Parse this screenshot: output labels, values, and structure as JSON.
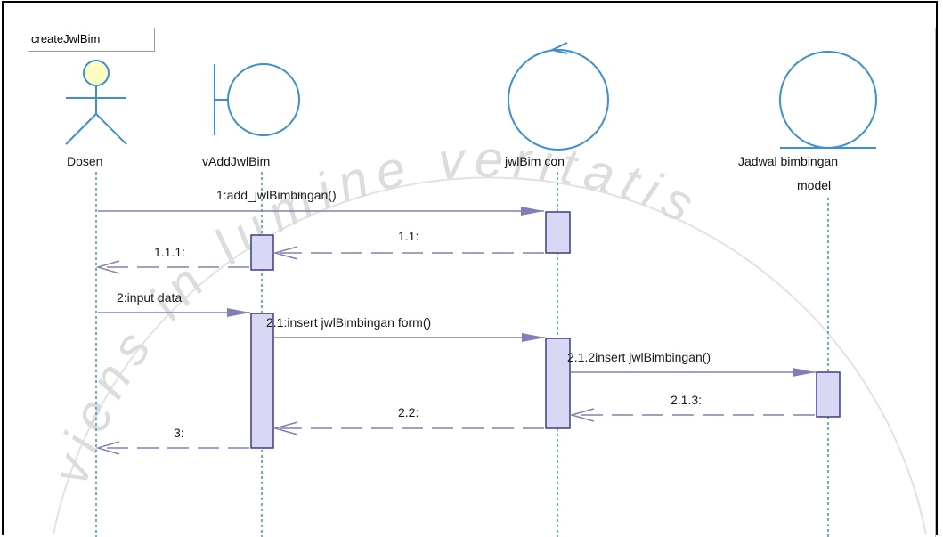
{
  "frame": {
    "name": "createJwlBim"
  },
  "lifelines": [
    {
      "id": "dosen",
      "kind": "actor",
      "name": "Dosen"
    },
    {
      "id": "view",
      "kind": "boundary",
      "name": "vAddJwlBim"
    },
    {
      "id": "controller",
      "kind": "control",
      "name": "jwlBim con"
    },
    {
      "id": "model",
      "kind": "entity",
      "name_line1": "Jadwal bimbingan",
      "name_line2": "model"
    }
  ],
  "messages": [
    {
      "label": "1:add_jwlBimbingan()",
      "from": "dosen",
      "to": "controller",
      "type": "call"
    },
    {
      "label": "1.1:",
      "from": "controller",
      "to": "view",
      "type": "return"
    },
    {
      "label": "1.1.1:",
      "from": "view",
      "to": "dosen",
      "type": "return"
    },
    {
      "label": "2:input data",
      "from": "dosen",
      "to": "view",
      "type": "call"
    },
    {
      "label": "2.1:insert jwlBimbingan form()",
      "from": "view",
      "to": "controller",
      "type": "call"
    },
    {
      "label": "2.1.2insert jwlBimbingan()",
      "from": "controller",
      "to": "model",
      "type": "call"
    },
    {
      "label": "2.1.3:",
      "from": "model",
      "to": "controller",
      "type": "return"
    },
    {
      "label": "2.2:",
      "from": "controller",
      "to": "view",
      "type": "return"
    },
    {
      "label": "3:",
      "from": "view",
      "to": "dosen",
      "type": "return"
    }
  ],
  "watermark": {
    "text": "viens in lumine veritatis"
  },
  "colors": {
    "symbol_stroke": "#3a8fd8",
    "symbol_fill": "#ffffff",
    "actor_head_fill": "#fffcc0",
    "lifeline": "#3a8fd8",
    "activation_fill": "#d8d8f4",
    "activation_stroke": "#3b3b8f",
    "message_line": "#8080b8",
    "watermark": "#d9d9d9"
  }
}
